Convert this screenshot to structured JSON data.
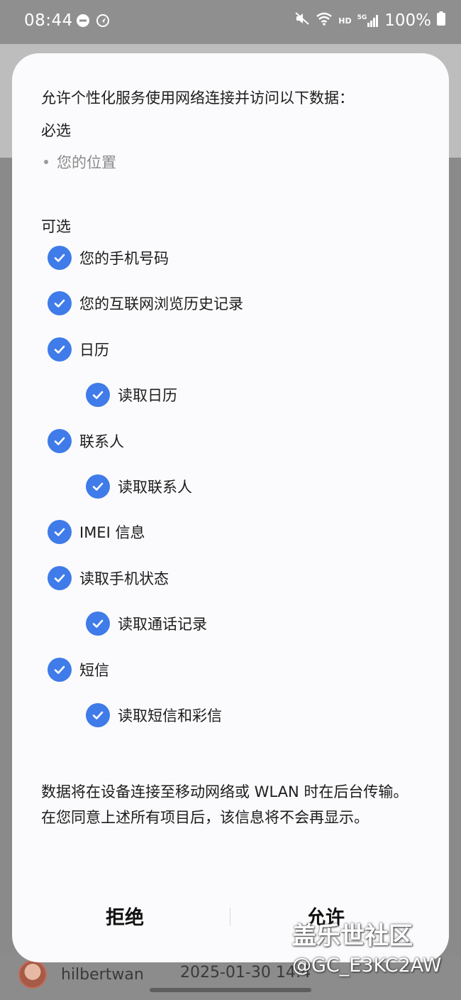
{
  "status_bar": {
    "time": "08:44",
    "battery": "100%",
    "network_hd": "HD",
    "network_5g": "5G",
    "icons": [
      "minus-circle-icon",
      "location-arrow-icon",
      "mute-icon",
      "wifi-icon",
      "signal-icon",
      "battery-icon"
    ]
  },
  "dialog": {
    "intro": "允许个性化服务使用网络连接并访问以下数据：",
    "required_label": "必选",
    "required_items": [
      "您的位置"
    ],
    "optional_label": "可选",
    "optional_items": [
      {
        "label": "您的手机号码",
        "checked": true,
        "level": 0
      },
      {
        "label": "您的互联网浏览历史记录",
        "checked": true,
        "level": 0
      },
      {
        "label": "日历",
        "checked": true,
        "level": 0
      },
      {
        "label": "读取日历",
        "checked": true,
        "level": 1
      },
      {
        "label": "联系人",
        "checked": true,
        "level": 0
      },
      {
        "label": "读取联系人",
        "checked": true,
        "level": 1
      },
      {
        "label": "IMEI 信息",
        "checked": true,
        "level": 0
      },
      {
        "label": "读取手机状态",
        "checked": true,
        "level": 0
      },
      {
        "label": "读取通话记录",
        "checked": true,
        "level": 1
      },
      {
        "label": "短信",
        "checked": true,
        "level": 0
      },
      {
        "label": "读取短信和彩信",
        "checked": true,
        "level": 1
      }
    ],
    "footer_line1": "数据将在设备连接至移动网络或 WLAN 时在后台传输。",
    "footer_line2": "在您同意上述所有项目后，该信息将不会再显示。",
    "deny_label": "拒绝",
    "allow_label": "允许"
  },
  "background": {
    "username": "hilbertwan",
    "date": "2025-01-30 14:4"
  },
  "watermark": {
    "site": "盖乐世社区",
    "user_id": "@GC_E3KC2AW"
  },
  "colors": {
    "accent": "#3f7be9",
    "dialog_bg": "#fbfbfd",
    "scrim": "#8e8e8e"
  }
}
